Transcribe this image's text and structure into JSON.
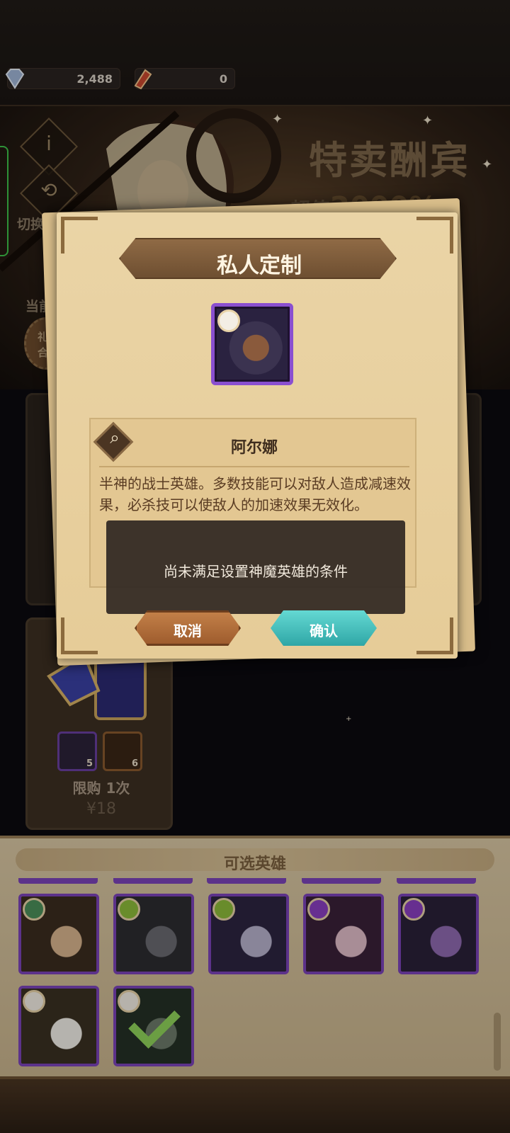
{
  "resources": {
    "diamonds": "2,488",
    "scrolls": "0"
  },
  "banner": {
    "title": "特卖酬宾",
    "subtitle_prefix": "超值",
    "subtitle_value": "2000%+",
    "side_buttons": [
      "切换",
      "当前"
    ],
    "gift_badge": [
      "礼包",
      "合集"
    ]
  },
  "shop_card": {
    "item_counts": [
      "5",
      "6"
    ],
    "limit": "限购 1次",
    "price": "¥18"
  },
  "modal": {
    "title": "私人定制",
    "hero_name": "阿尔娜",
    "hero_description": "半神的战士英雄。多数技能可以对敌人造成减速效果，必杀技可以使敌人的加速效果无效化。",
    "toast": "尚未满足设置神魔英雄的条件",
    "cancel_label": "取消",
    "confirm_label": "确认"
  },
  "picker": {
    "title": "可选英雄",
    "heroes": [
      {
        "faction": "wilder",
        "color": "#4b8f5a",
        "selected": false
      },
      {
        "faction": "graveborn",
        "color": "#8dbb3a",
        "selected": false
      },
      {
        "faction": "graveborn",
        "color": "#8dbb3a",
        "selected": false
      },
      {
        "faction": "hypogean",
        "color": "#8a3fc1",
        "selected": false
      },
      {
        "faction": "hypogean",
        "color": "#8a3fc1",
        "selected": false
      },
      {
        "faction": "celestial",
        "color": "#f3eee4",
        "selected": false
      },
      {
        "faction": "celestial",
        "color": "#f3eee4",
        "selected": true
      }
    ]
  },
  "colors": {
    "accent_purple": "#7b43b8",
    "confirm_teal": "#3fc3c0",
    "cancel_brown": "#b06a38"
  }
}
